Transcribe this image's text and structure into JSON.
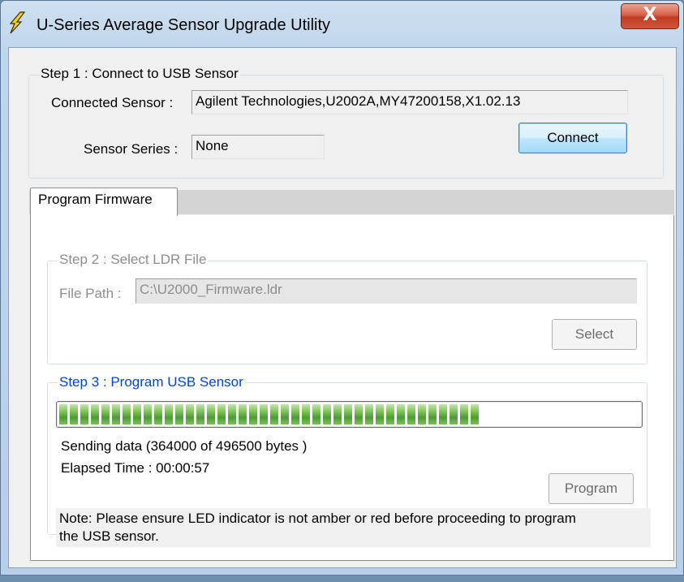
{
  "window": {
    "title": "U-Series Average Sensor Upgrade Utility",
    "close_glyph": "X",
    "app_icon": "lightning-icon"
  },
  "step1": {
    "legend": "Step 1 : Connect to USB Sensor",
    "connected_label": "Connected Sensor :",
    "connected_value": "Agilent Technologies,U2002A,MY47200158,X1.02.13",
    "series_label": "Sensor Series :",
    "series_value": "None",
    "connect_button": "Connect"
  },
  "tabs": [
    {
      "label": "Program Firmware"
    }
  ],
  "step2": {
    "legend": "Step 2 : Select LDR File",
    "file_path_label": "File Path :",
    "file_path_value": "C:\\U2000_Firmware.ldr",
    "select_button": "Select"
  },
  "step3": {
    "legend": "Step 3 : Program USB Sensor",
    "progress_fraction": 0.733,
    "status_text": "Sending data (364000 of 496500 bytes )",
    "elapsed_text": "Elapsed Time : 00:00:57",
    "program_button": "Program",
    "note_line1": "Note: Please ensure LED indicator is not amber or red before proceeding to program",
    "note_line2": "the USB sensor."
  },
  "colors": {
    "progress_green": "#4f9a36",
    "step3_legend": "#0046d5",
    "title_bar": "#c0d6ec"
  }
}
